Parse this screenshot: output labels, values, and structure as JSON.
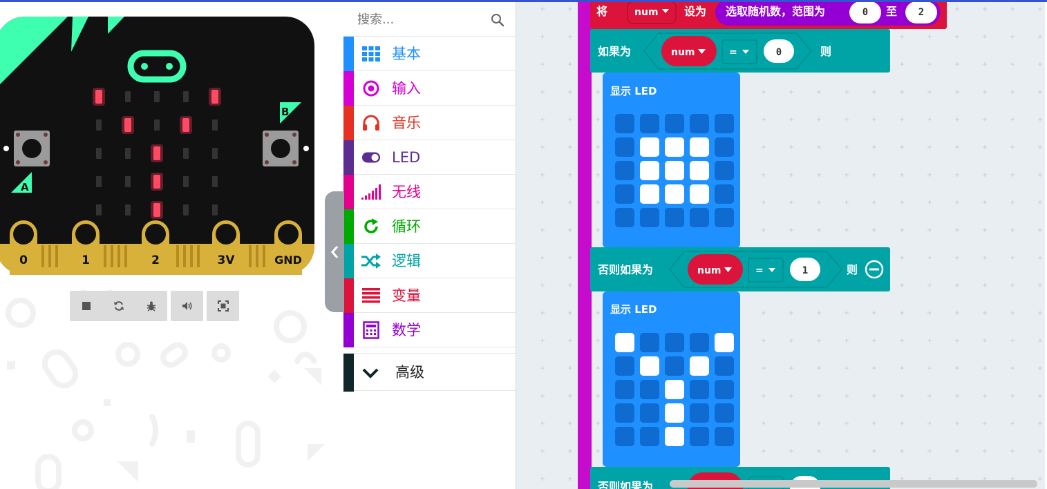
{
  "simulator": {
    "pins": [
      "0",
      "1",
      "2",
      "3V",
      "GND"
    ],
    "buttons": {
      "a": "A",
      "b": "B"
    },
    "led_matrix": [
      [
        1,
        0,
        0,
        0,
        1
      ],
      [
        0,
        1,
        0,
        1,
        0
      ],
      [
        0,
        0,
        1,
        0,
        0
      ],
      [
        0,
        0,
        1,
        0,
        0
      ],
      [
        0,
        0,
        1,
        0,
        0
      ]
    ],
    "controls": [
      "stop-icon",
      "restart-icon",
      "debug-icon",
      "mute-icon",
      "fullscreen-icon"
    ]
  },
  "toolbox": {
    "search_placeholder": "搜索...",
    "categories": [
      {
        "label": "基本",
        "color": "#1e90ff",
        "icon": "grid-icon"
      },
      {
        "label": "输入",
        "color": "#d400d4",
        "icon": "target-icon"
      },
      {
        "label": "音乐",
        "color": "#e63022",
        "icon": "headphones-icon"
      },
      {
        "label": "LED",
        "color": "#5c2d91",
        "icon": "toggle-icon"
      },
      {
        "label": "无线",
        "color": "#e3008c",
        "icon": "signal-icon"
      },
      {
        "label": "循环",
        "color": "#00aa00",
        "icon": "refresh-icon"
      },
      {
        "label": "逻辑",
        "color": "#00a4a6",
        "icon": "shuffle-icon"
      },
      {
        "label": "变量",
        "color": "#dc143c",
        "icon": "list-icon"
      },
      {
        "label": "数学",
        "color": "#9400d3",
        "icon": "calculator-icon"
      }
    ],
    "advanced": {
      "label": "高级",
      "icon": "chevron-down-icon"
    }
  },
  "workspace": {
    "set_block": {
      "keyword": "将",
      "var": "num",
      "to": "设为",
      "random": "选取随机数，范围为",
      "from": "0",
      "sep": "至",
      "to_val": "2"
    },
    "if_block": {
      "keyword": "如果为",
      "var": "num",
      "op": "=",
      "value": "0",
      "then": "则"
    },
    "show_led_1": {
      "label": "显示 LED",
      "matrix": [
        [
          0,
          0,
          0,
          0,
          0
        ],
        [
          0,
          1,
          1,
          1,
          0
        ],
        [
          0,
          1,
          1,
          1,
          0
        ],
        [
          0,
          1,
          1,
          1,
          0
        ],
        [
          0,
          0,
          0,
          0,
          0
        ]
      ]
    },
    "else_if_block": {
      "keyword": "否则如果为",
      "var": "num",
      "op": "=",
      "value": "1",
      "then": "则"
    },
    "show_led_2": {
      "label": "显示 LED",
      "matrix": [
        [
          1,
          0,
          0,
          0,
          1
        ],
        [
          0,
          1,
          0,
          1,
          0
        ],
        [
          0,
          0,
          1,
          0,
          0
        ],
        [
          0,
          0,
          1,
          0,
          0
        ],
        [
          0,
          0,
          1,
          0,
          0
        ]
      ]
    },
    "else_if_block_2": {
      "keyword": "否则如果为"
    }
  },
  "colors": {
    "variables": "#dc143c",
    "logic": "#00a4a6",
    "basic": "#1e90ff",
    "math": "#9400d3",
    "spine": "#c60bcc"
  }
}
